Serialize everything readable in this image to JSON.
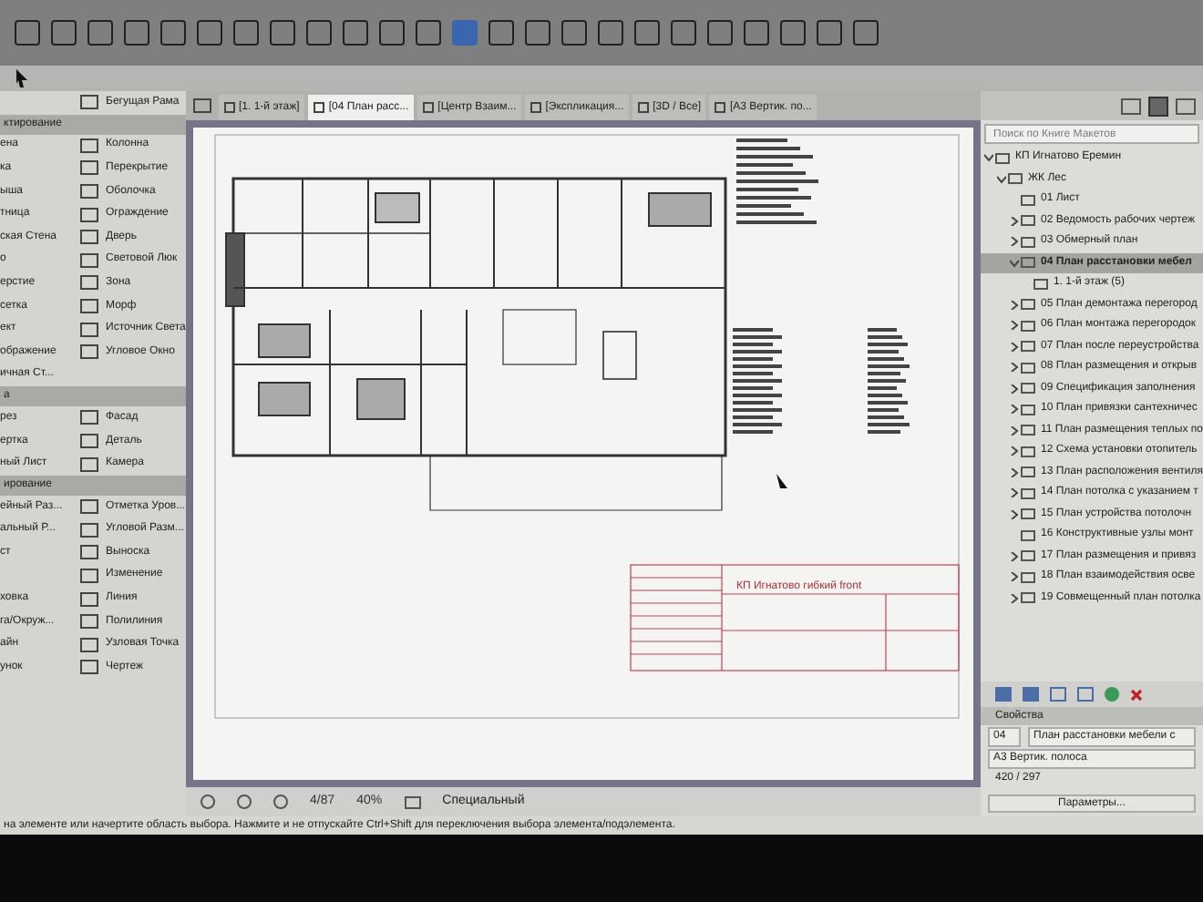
{
  "tabs": [
    {
      "label": "[1. 1-й этаж]",
      "selected": false
    },
    {
      "label": "[04 План расс...",
      "selected": true
    },
    {
      "label": "[Центр Взаим...",
      "selected": false
    },
    {
      "label": "[Экспликация...",
      "selected": false
    },
    {
      "label": "[3D / Все]",
      "selected": false
    },
    {
      "label": "[А3 Вертик. по...",
      "selected": false
    }
  ],
  "toolbox": [
    {
      "rows": [
        {
          "right": "Бегущая Рама"
        }
      ]
    },
    {
      "header": "ктирование",
      "rows": [
        {
          "left": "ена",
          "right": "Колонна"
        },
        {
          "left": "ка",
          "right": "Перекрытие"
        },
        {
          "left": "ыша",
          "right": "Оболочка"
        },
        {
          "left": "тница",
          "right": "Ограждение"
        },
        {
          "left": "ская Стена",
          "right": "Дверь"
        },
        {
          "left": "о",
          "right": "Световой Люк"
        },
        {
          "left": "ерстие",
          "right": "Зона"
        },
        {
          "left": "сетка",
          "right": "Морф"
        },
        {
          "left": "ект",
          "right": "Источник Света"
        },
        {
          "left": "ображение",
          "right": "Угловое Окно"
        },
        {
          "left": "ичная Ст..."
        }
      ]
    },
    {
      "header": "а",
      "rows": [
        {
          "left": "рез",
          "right": "Фасад"
        },
        {
          "left": "ертка",
          "right": "Деталь"
        },
        {
          "left": "ный Лист",
          "right": "Камера"
        }
      ]
    },
    {
      "header": "ирование",
      "rows": [
        {
          "left": "ейный Раз...",
          "right": "Отметка Уров..."
        },
        {
          "left": "альный Р...",
          "right": "Угловой Разм..."
        },
        {
          "left": "ст",
          "right": "Выноска"
        },
        {
          "right": "Изменение"
        },
        {
          "left": "ховка",
          "right": "Линия"
        },
        {
          "left": "га/Окруж...",
          "right": "Полилиния"
        },
        {
          "left": "айн",
          "right": "Узловая Точка"
        },
        {
          "left": "унок",
          "right": "Чертеж"
        }
      ]
    }
  ],
  "sheet": {
    "title_block": "КП Игнатово гибкий front"
  },
  "navigator": {
    "search": {
      "placeholder": "Поиск по Книге Макетов"
    },
    "tree": [
      {
        "label": "КП Игнатово Еремин",
        "expanded": true,
        "selected": false,
        "children": [
          {
            "label": "ЖК Лес",
            "expanded": true,
            "selected": false,
            "children": [
              {
                "label": "01 Лист",
                "selected": false
              },
              {
                "label": "02 Ведомость рабочих чертеж",
                "expanded": false,
                "selected": false
              },
              {
                "label": "03 Обмерный план",
                "expanded": false,
                "selected": false
              },
              {
                "label": "04 План расстановки мебел",
                "expanded": true,
                "selected": true,
                "children": [
                  {
                    "label": "1. 1-й этаж (5)",
                    "selected": false
                  }
                ]
              },
              {
                "label": "05 План демонтажа перегород",
                "expanded": false,
                "selected": false
              },
              {
                "label": "06 План монтажа перегородок",
                "expanded": false,
                "selected": false
              },
              {
                "label": "07 План после переустройства",
                "expanded": false,
                "selected": false
              },
              {
                "label": "08 План размещения и открыв",
                "expanded": false,
                "selected": false
              },
              {
                "label": "09 Спецификация заполнения",
                "expanded": false,
                "selected": false
              },
              {
                "label": "10 План привязки сантехничес",
                "expanded": false,
                "selected": false
              },
              {
                "label": "11 План размещения теплых по",
                "expanded": false,
                "selected": false
              },
              {
                "label": "12 Схема установки отопитель",
                "expanded": false,
                "selected": false
              },
              {
                "label": "13 План расположения вентиля",
                "expanded": false,
                "selected": false
              },
              {
                "label": "14 План потолка с указанием т",
                "expanded": false,
                "selected": false
              },
              {
                "label": "15 План устройства потолочн",
                "expanded": false,
                "selected": false
              },
              {
                "label": "16 Конструктивные узлы монт",
                "selected": false
              },
              {
                "label": "17 План размещения и привяз",
                "expanded": false,
                "selected": false
              },
              {
                "label": "18 План взаимодействия осве",
                "expanded": false,
                "selected": false
              },
              {
                "label": "19 Совмещенный план потолка",
                "expanded": false,
                "selected": false
              }
            ]
          }
        ]
      }
    ]
  },
  "properties": {
    "header": "Свойства",
    "number": "04",
    "name": "План расстановки мебели с",
    "format": "А3 Вертик. полоса",
    "size": "420 / 297",
    "button": "Параметры..."
  },
  "bottom_bar": {
    "page": "4/87",
    "zoom": "40%",
    "mode": "Специальный"
  },
  "status_bar": "на элементе или начертите область выбора. Нажмите и не отпускайте Ctrl+Shift для переключения выбора элемента/подэлемента."
}
